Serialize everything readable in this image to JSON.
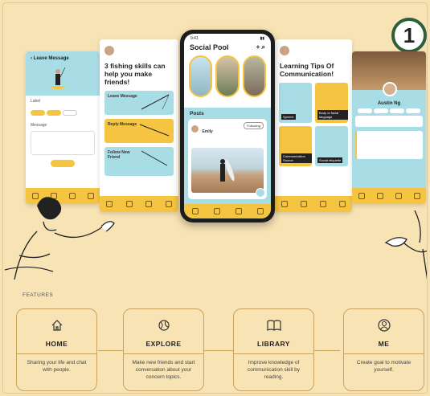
{
  "badge": "1",
  "screens": {
    "leave_message": {
      "header": "Leave Message",
      "label_field": "Label",
      "message_field": "Message"
    },
    "fishing": {
      "title": "3 fishing skills can help you make friends!",
      "cards": [
        {
          "label": "Leave Message"
        },
        {
          "label": "Reply Message"
        },
        {
          "label": "Follow New Friend"
        }
      ]
    },
    "social_pool": {
      "status_time": "9:41",
      "title": "Social Pool",
      "posts_header": "Posts",
      "post_user": "Emily",
      "follow_label": "Following"
    },
    "learning": {
      "title": "Learning Tips Of Communication!",
      "tiles": [
        {
          "caption": "Speech",
          "color": "#a9dde6"
        },
        {
          "caption": "Body or facial language",
          "color": "#f5c542"
        },
        {
          "caption": "Communication Source",
          "color": "#f5c542"
        },
        {
          "caption": "Social etiquette",
          "color": "#a9dde6"
        }
      ]
    },
    "profile": {
      "name": "Austin Ng"
    }
  },
  "features_label": "FEATURES",
  "features": [
    {
      "icon": "home-icon",
      "title": "HOME",
      "desc": "Sharing your life and chat with people."
    },
    {
      "icon": "globe-icon",
      "title": "EXPLORE",
      "desc": "Make new friends and start conversation about your concern topics."
    },
    {
      "icon": "book-icon",
      "title": "LIBRARY",
      "desc": "Improve knowledge of communication skill by reading."
    },
    {
      "icon": "user-icon",
      "title": "ME",
      "desc": "Create goal to motivate yourself."
    }
  ],
  "colors": {
    "background": "#f8e3b5",
    "accent_yellow": "#f5c542",
    "accent_blue": "#a9dde6",
    "badge_ring": "#2e5f3b"
  }
}
